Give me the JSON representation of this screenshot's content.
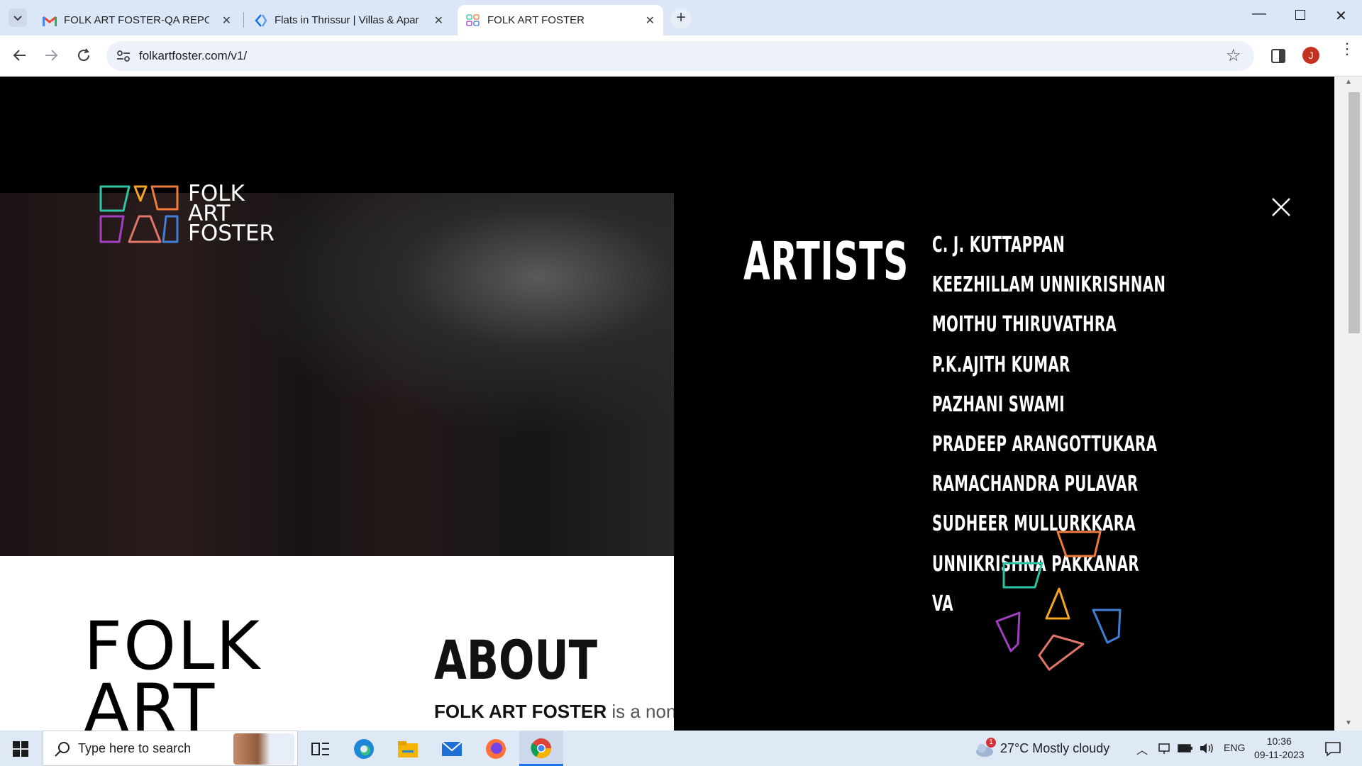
{
  "browser": {
    "tabs": [
      {
        "title": "FOLK ART FOSTER-QA REPORT",
        "favicon": "gmail-icon"
      },
      {
        "title": "Flats in Thrissur | Villas & Apar",
        "favicon": "site-icon"
      },
      {
        "title": "FOLK ART FOSTER",
        "favicon": "folkart-icon"
      }
    ],
    "url": "folkartfoster.com/v1/",
    "profile_initial": "J"
  },
  "site": {
    "logo_lines": [
      "FOLK",
      "ART",
      "FOSTER"
    ],
    "artists_heading": "ARTISTS",
    "artists": [
      "C. J. KUTTAPPAN",
      "KEEZHILLAM UNNIKRISHNAN",
      "MOITHU THIRUVATHRA",
      "P.K.AJITH KUMAR",
      "PAZHANI SWAMI",
      "PRADEEP ARANGOTTUKARA",
      "RAMACHANDRA PULAVAR",
      "SUDHEER MULLURKKARA",
      "UNNIKRISHNA PAKKANAR",
      "VAR."
    ],
    "big_title_lines": [
      "FOLK",
      "ART"
    ],
    "about_heading": "ABOUT",
    "about_brand": "FOLK ART FOSTER",
    "about_text": " is a non-pr"
  },
  "taskbar": {
    "search_placeholder": "Type here to search",
    "weather": "27°C  Mostly cloudy",
    "weather_badge": "1",
    "language": "ENG",
    "time": "10:36",
    "date": "09-11-2023"
  },
  "colors": {
    "teal": "#2ec4a6",
    "orange": "#f07a3a",
    "yellow": "#f5a623",
    "purple": "#a23fbf",
    "blue": "#3f7fd6",
    "rose": "#e0766a"
  }
}
